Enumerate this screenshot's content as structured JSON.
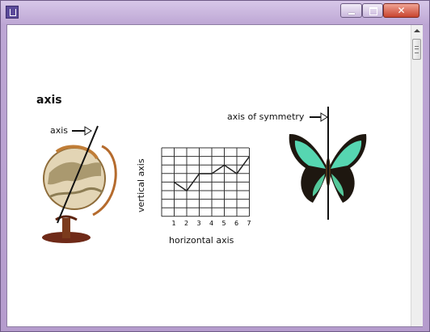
{
  "window": {
    "title": ""
  },
  "content": {
    "heading": "axis",
    "globe": {
      "label": "axis"
    },
    "graph": {
      "vertical_label": "vertical axis",
      "horizontal_label": "horizontal axis",
      "ticks": [
        "1",
        "2",
        "3",
        "4",
        "5",
        "6",
        "7"
      ],
      "y_values": [
        4,
        3,
        5,
        5,
        6,
        5,
        7
      ]
    },
    "butterfly": {
      "label": "axis of symmetry"
    }
  },
  "colors": {
    "frame": "#b59ccd",
    "close_button": "#c8442f",
    "content_bg": "#ffffff"
  }
}
